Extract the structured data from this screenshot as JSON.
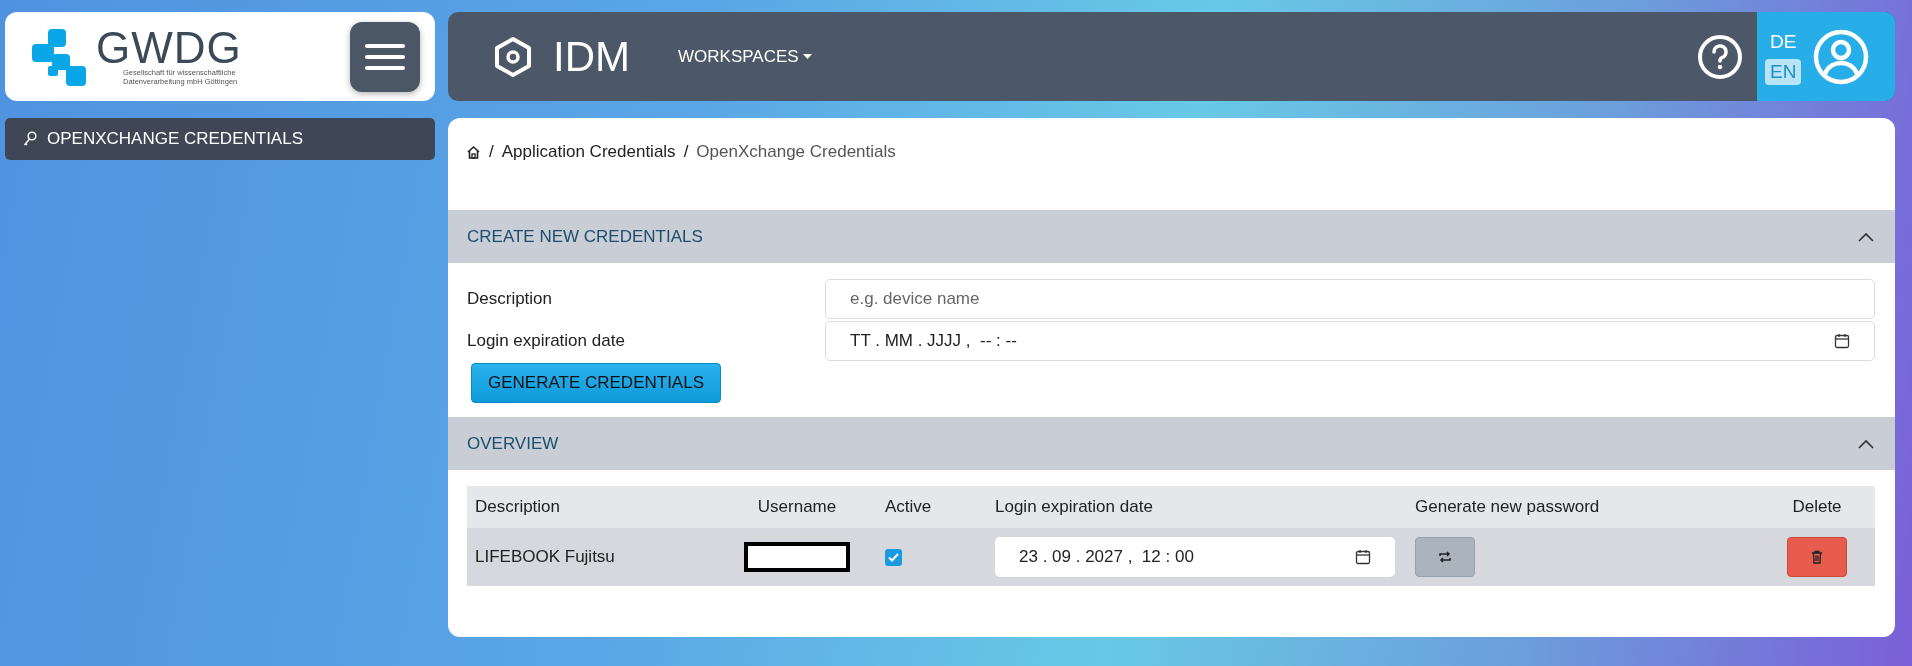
{
  "logo": {
    "wordmark": "GWDG",
    "tagline_line_1": "Gesellschaft für wissenschaftliche",
    "tagline_line_2": "Datenverarbeitung mbH Göttingen"
  },
  "sidebar": {
    "items": [
      {
        "label": "OPENXCHANGE CREDENTIALS",
        "selected": true
      }
    ]
  },
  "header": {
    "title": "IDM",
    "menu": "WORKSPACES",
    "languages": [
      {
        "label": "DE",
        "selected": false
      },
      {
        "label": "EN",
        "selected": true
      }
    ]
  },
  "breadcrumb": [
    {
      "separator": "/",
      "label": "Application Credentials"
    },
    {
      "separator": "/",
      "label": "OpenXchange Credentials"
    }
  ],
  "create_section": {
    "title": "CREATE NEW CREDENTIALS",
    "expanded": true,
    "description_label": "Description",
    "description_placeholder": "e.g. device name",
    "date_label": "Login expiration date",
    "date_placeholder": "TT . MM . JJJJ ,  -- : --",
    "button": "GENERATE CREDENTIALS"
  },
  "overview_section": {
    "title": "OVERVIEW",
    "expanded": true,
    "table": {
      "columns": [
        "Description",
        "Username",
        "Active",
        "Login expiration date",
        "Generate new password",
        "Delete"
      ],
      "rows": [
        {
          "description": "LIFEBOOK Fujitsu",
          "active": true,
          "expiration": "23 . 09 . 2027 ,  12 : 00"
        }
      ]
    }
  }
}
